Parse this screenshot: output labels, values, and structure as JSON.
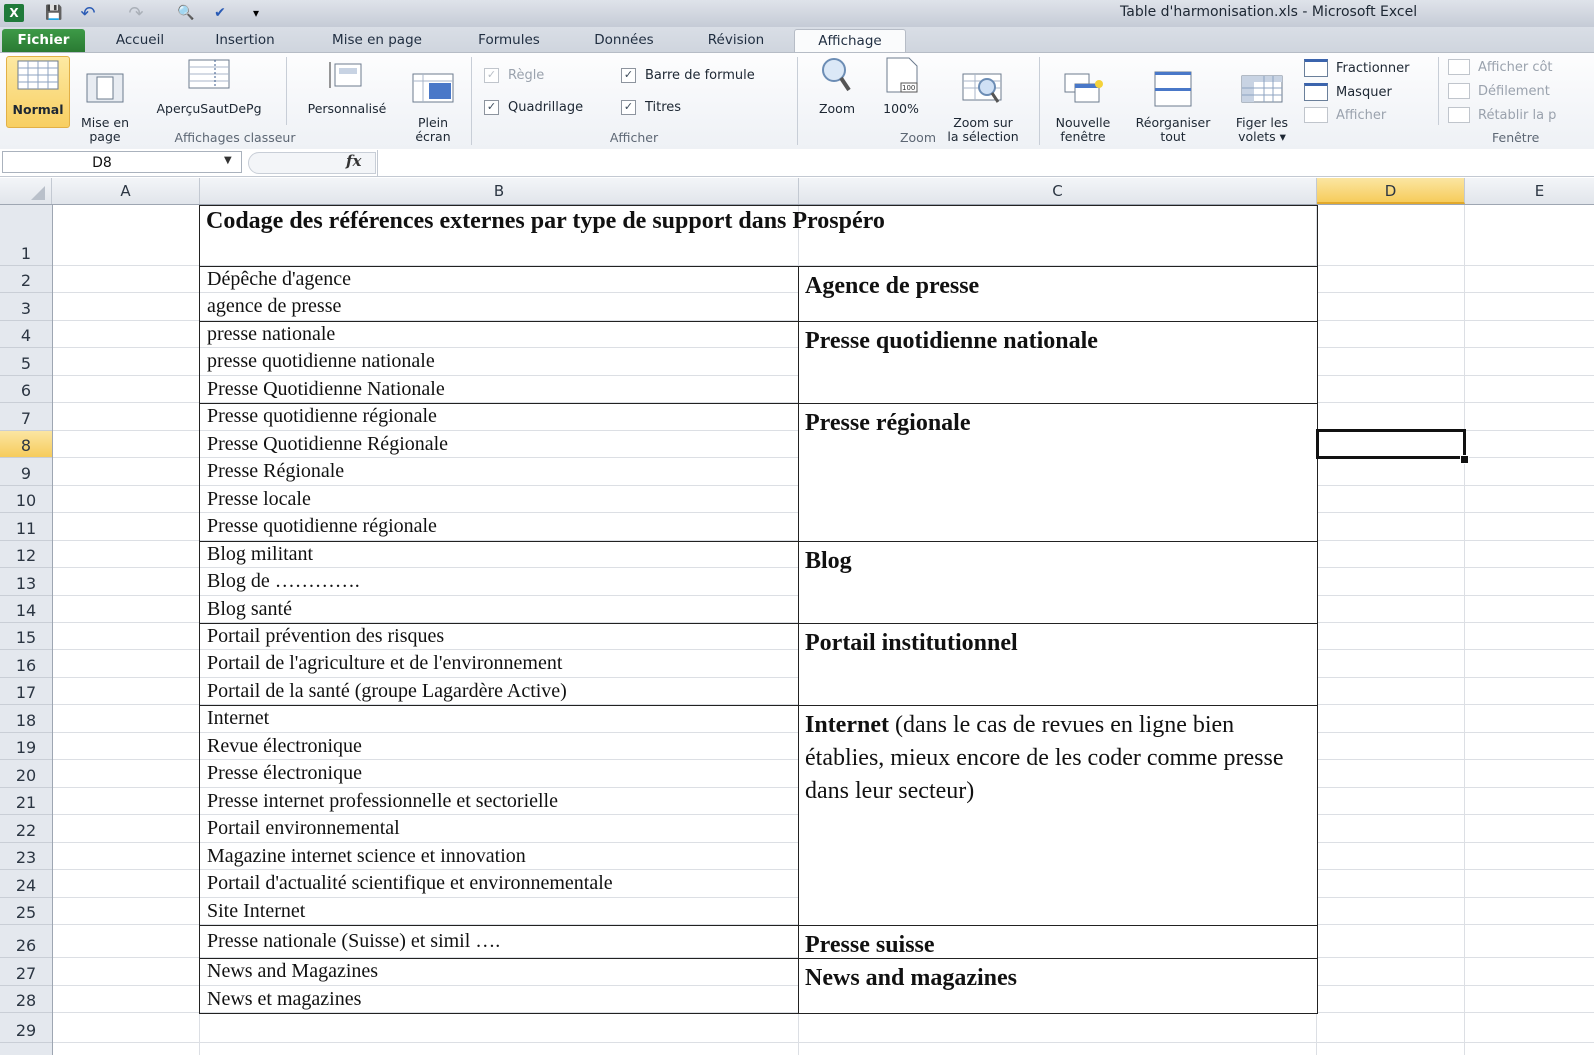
{
  "window": {
    "title": "Table d'harmonisation.xls  -  Microsoft Excel",
    "app_icon": "excel-logo-icon",
    "quick_access": [
      {
        "name": "save-icon",
        "glyph": "💾"
      },
      {
        "name": "undo-icon",
        "glyph": "↶"
      },
      {
        "name": "redo-icon",
        "glyph": "↷"
      },
      {
        "name": "print-preview-icon",
        "glyph": "🔍"
      },
      {
        "name": "spelling-icon",
        "glyph": "✔"
      },
      {
        "name": "customize-qat-icon",
        "glyph": "▾"
      }
    ]
  },
  "tabs": [
    {
      "label": "Fichier"
    },
    {
      "label": "Accueil"
    },
    {
      "label": "Insertion"
    },
    {
      "label": "Mise en page"
    },
    {
      "label": "Formules"
    },
    {
      "label": "Données"
    },
    {
      "label": "Révision"
    },
    {
      "label": "Affichage",
      "active": true
    }
  ],
  "ribbon": {
    "groups": {
      "workbook_views": {
        "label": "Affichages classeur",
        "buttons": [
          {
            "label": "Normal",
            "selected": true
          },
          {
            "label": "Mise en\npage"
          },
          {
            "label": "AperçuSautDePg"
          },
          {
            "label": "Personnalisé"
          },
          {
            "label": "Plein\nécran"
          }
        ]
      },
      "show": {
        "label": "Afficher",
        "checkboxes": [
          {
            "label": "Règle",
            "checked": true,
            "disabled": true
          },
          {
            "label": "Barre de formule",
            "checked": true
          },
          {
            "label": "Quadrillage",
            "checked": true
          },
          {
            "label": "Titres",
            "checked": true
          }
        ]
      },
      "zoom": {
        "label": "Zoom",
        "buttons": [
          {
            "label": "Zoom"
          },
          {
            "label": "100%"
          },
          {
            "label": "Zoom sur\nla sélection"
          }
        ]
      },
      "window": {
        "label": "Fenêtre",
        "buttons": [
          {
            "label": "Nouvelle\nfenêtre"
          },
          {
            "label": "Réorganiser\ntout"
          },
          {
            "label": "Figer les\nvolets ▾"
          }
        ],
        "small": [
          {
            "label": "Fractionner"
          },
          {
            "label": "Masquer"
          },
          {
            "label": "Afficher",
            "disabled": true
          },
          {
            "label": "Afficher côt",
            "disabled": true
          },
          {
            "label": "Défilement",
            "disabled": true
          },
          {
            "label": "Rétablir la p",
            "disabled": true
          }
        ]
      }
    }
  },
  "formula_bar": {
    "name_box": "D8",
    "fx_label": "fx",
    "formula": ""
  },
  "sheet": {
    "columns": [
      "A",
      "B",
      "C",
      "D",
      "E"
    ],
    "selected_column": "D",
    "selected_row": 8,
    "active_cell": "D8",
    "rows": [
      "1",
      "2",
      "3",
      "4",
      "5",
      "6",
      "7",
      "8",
      "9",
      "10",
      "11",
      "12",
      "13",
      "14",
      "15",
      "16",
      "17",
      "18",
      "19",
      "20",
      "21",
      "22",
      "23",
      "24",
      "25",
      "26",
      "27",
      "28",
      "29"
    ],
    "title": "Codage des références externes par type de support dans Prospéro",
    "column_b": [
      "Dépêche d'agence",
      "agence de presse",
      "presse nationale",
      "presse quotidienne nationale",
      "Presse Quotidienne Nationale",
      "Presse quotidienne régionale",
      "Presse Quotidienne Régionale",
      "Presse Régionale",
      "Presse locale",
      "Presse quotidienne régionale",
      "Blog militant",
      "Blog de ………….",
      "Blog santé",
      "Portail prévention des risques",
      "Portail de l'agriculture et de l'environnement",
      "Portail de la santé (groupe Lagardère Active)",
      "Internet",
      "Revue électronique",
      "Presse électronique",
      "Presse internet professionnelle et sectorielle",
      "Portail environnemental",
      "Magazine internet science et innovation",
      "Portail d'actualité scientifique et environnementale",
      "Site Internet",
      "Presse nationale (Suisse) et simil ….",
      "News and Magazines",
      "News et magazines"
    ],
    "groups": [
      {
        "code": "Agence de presse",
        "rows": "2-3"
      },
      {
        "code": "Presse quotidienne nationale",
        "rows": "4-6"
      },
      {
        "code": "Presse régionale",
        "rows": "7-11"
      },
      {
        "code": "Blog",
        "rows": "12-14"
      },
      {
        "code": "Portail institutionnel",
        "rows": "15-17"
      },
      {
        "code": "Internet",
        "note": " (dans le cas de revues en ligne bien établies, mieux encore de les coder comme presse dans leur secteur)",
        "rows": "18-25"
      },
      {
        "code": "Presse suisse",
        "rows": "26"
      },
      {
        "code": "News and magazines",
        "rows": "27-28"
      }
    ]
  },
  "colors": {
    "file_tab": "#2a7a33",
    "selection_header": "#f6cc5c",
    "grid": "#dcdfe4",
    "border": "#222222"
  }
}
